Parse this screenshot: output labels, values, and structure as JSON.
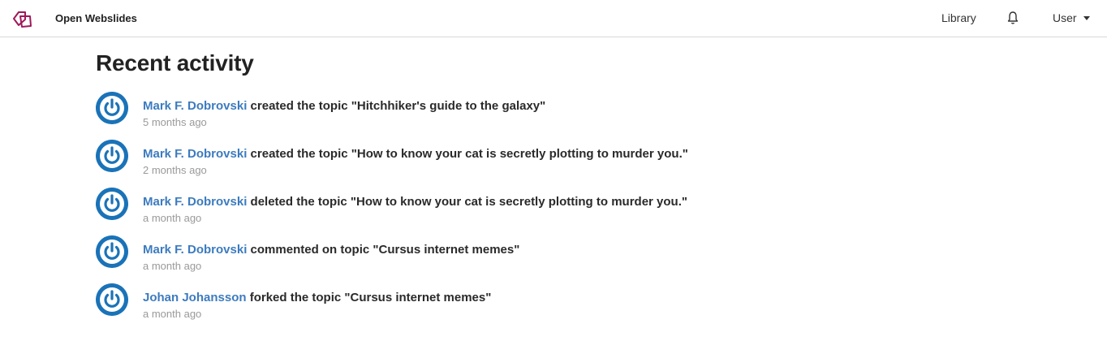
{
  "header": {
    "brand": "Open Webslides",
    "library_label": "Library",
    "user_label": "User",
    "accent_color": "#a0185b"
  },
  "main": {
    "title": "Recent activity",
    "activities": [
      {
        "actor": "Mark F. Dobrovski",
        "action": "created the topic \"Hitchhiker's guide to the galaxy\"",
        "time": "5 months ago"
      },
      {
        "actor": "Mark F. Dobrovski",
        "action": "created the topic \"How to know your cat is secretly plotting to murder you.\"",
        "time": "2 months ago"
      },
      {
        "actor": "Mark F. Dobrovski",
        "action": "deleted the topic \"How to know your cat is secretly plotting to murder you.\"",
        "time": "a month ago"
      },
      {
        "actor": "Mark F. Dobrovski",
        "action": "commented on topic \"Cursus internet memes\"",
        "time": "a month ago"
      },
      {
        "actor": "Johan Johansson",
        "action": "forked the topic \"Cursus internet memes\"",
        "time": "a month ago"
      }
    ]
  },
  "icons": {
    "logo": "openwebslides-logo-icon",
    "bell": "bell-icon",
    "caret": "caret-down-icon",
    "avatar": "power-avatar-icon"
  },
  "colors": {
    "link": "#3c7bbf",
    "avatar_bg": "#1a73b8",
    "timestamp": "#9a9a9a"
  }
}
